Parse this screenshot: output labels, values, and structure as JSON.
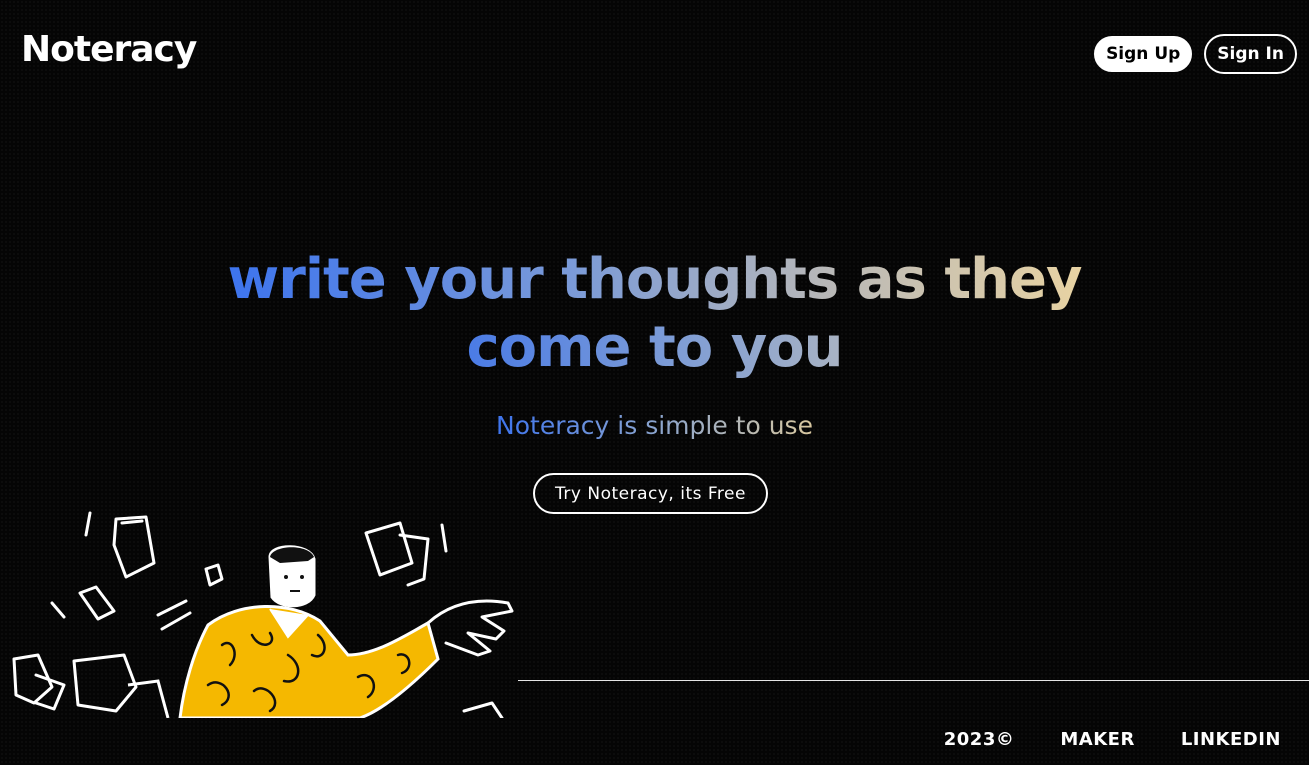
{
  "header": {
    "logo_text": "Noteracy",
    "signup_label": "Sign Up",
    "signin_label": "Sign In"
  },
  "hero": {
    "headline_line1": "write your thoughts as they",
    "headline_line2": "come to you",
    "subline": "Noteracy is simple to use",
    "cta_label": "Try Noteracy, its Free"
  },
  "footer": {
    "year": "2023©",
    "maker_label": "MAKER",
    "linkedin_label": "LINKEDIN"
  },
  "colors": {
    "background": "#050505",
    "gradient_blue": "#3d74ee",
    "gradient_cream": "#e8d3a3",
    "illustration_yellow": "#f5b800"
  }
}
